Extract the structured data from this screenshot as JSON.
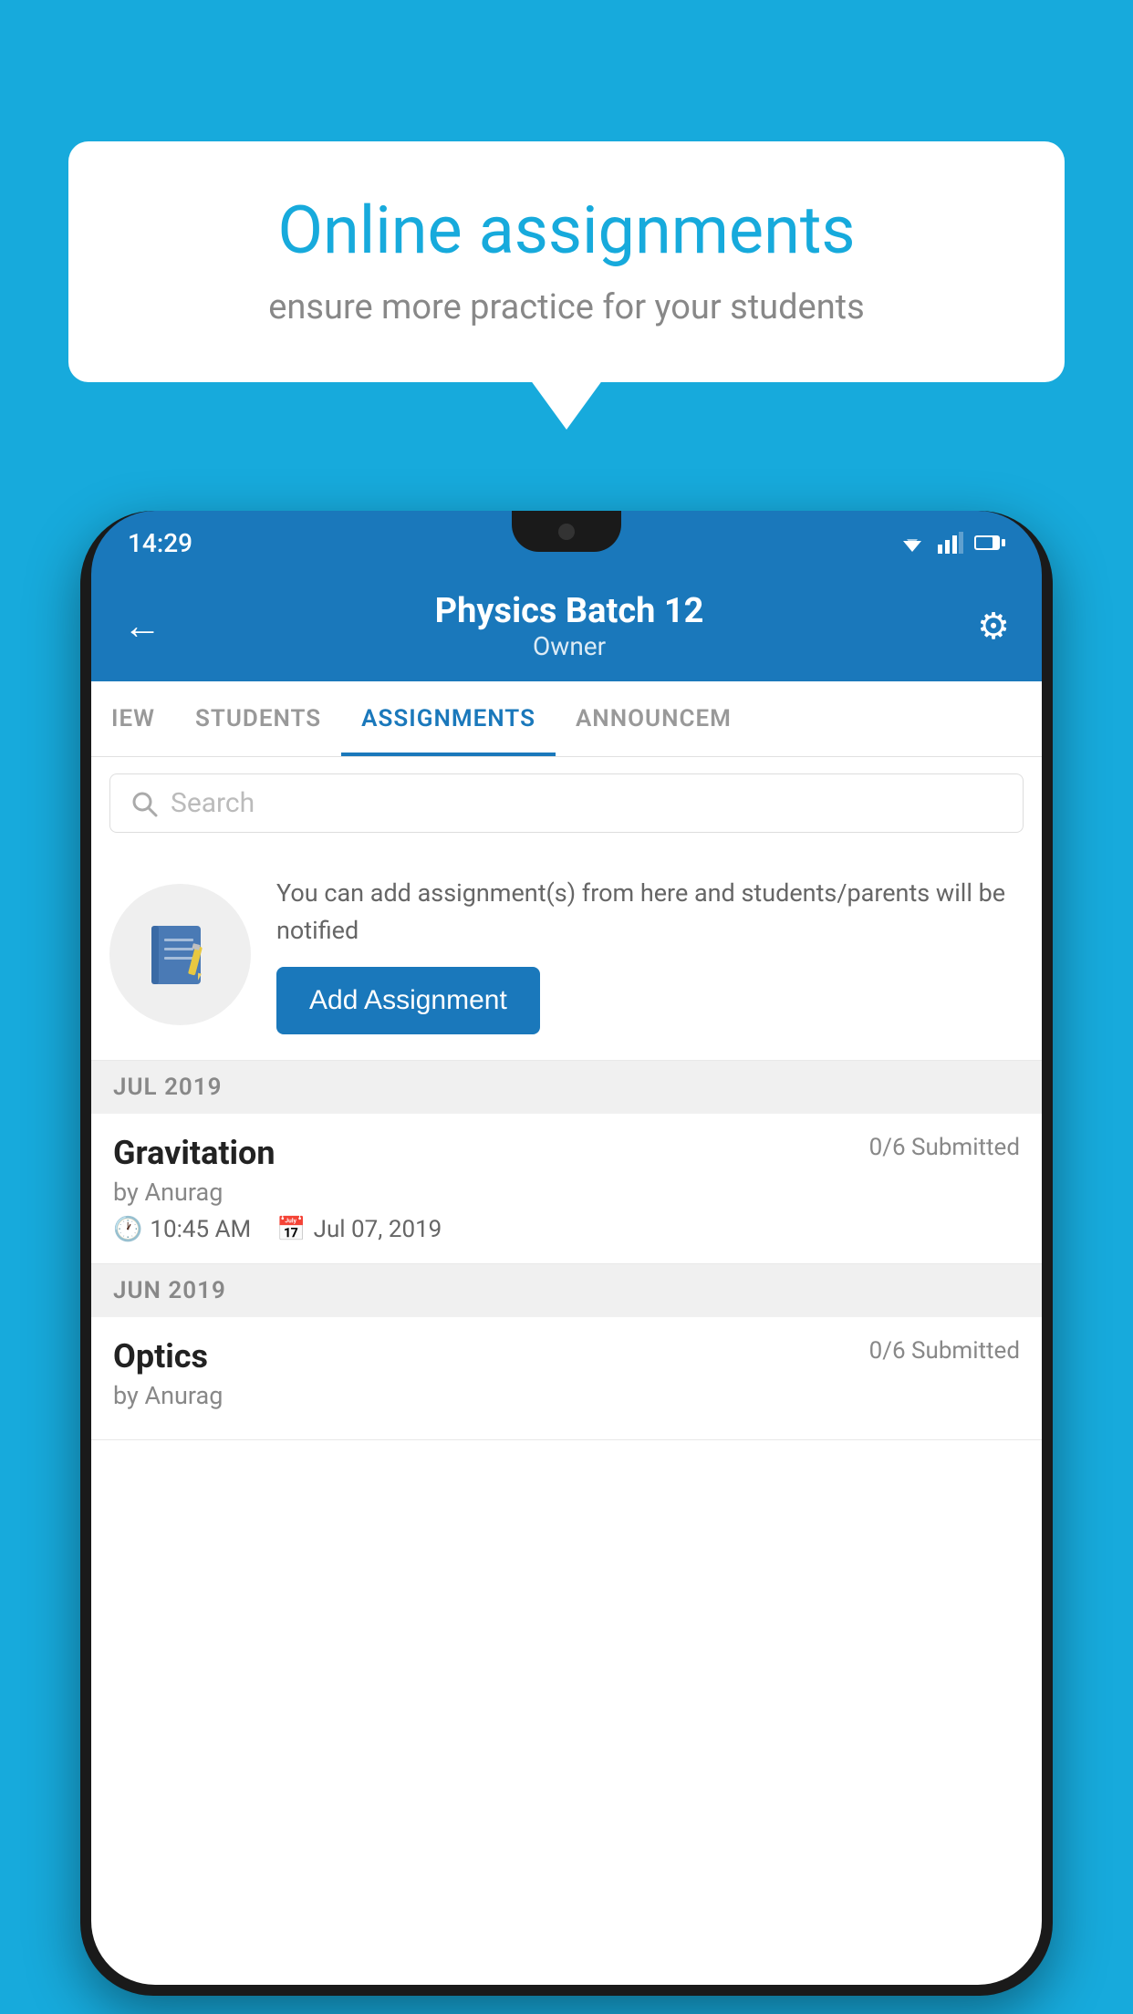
{
  "background_color": "#17AADC",
  "speech_bubble": {
    "title": "Online assignments",
    "subtitle": "ensure more practice for your students"
  },
  "status_bar": {
    "time": "14:29"
  },
  "app_header": {
    "title": "Physics Batch 12",
    "subtitle": "Owner",
    "back_label": "←",
    "gear_label": "⚙"
  },
  "tabs": [
    {
      "label": "IEW",
      "active": false
    },
    {
      "label": "STUDENTS",
      "active": false
    },
    {
      "label": "ASSIGNMENTS",
      "active": true
    },
    {
      "label": "ANNOUNCEM",
      "active": false
    }
  ],
  "search": {
    "placeholder": "Search"
  },
  "promo": {
    "text": "You can add assignment(s) from here and students/parents will be notified",
    "button_label": "Add Assignment"
  },
  "month_sections": [
    {
      "month": "JUL 2019",
      "assignments": [
        {
          "name": "Gravitation",
          "submitted": "0/6 Submitted",
          "by": "by Anurag",
          "time": "10:45 AM",
          "date": "Jul 07, 2019"
        }
      ]
    },
    {
      "month": "JUN 2019",
      "assignments": [
        {
          "name": "Optics",
          "submitted": "0/6 Submitted",
          "by": "by Anurag",
          "time": "",
          "date": ""
        }
      ]
    }
  ]
}
